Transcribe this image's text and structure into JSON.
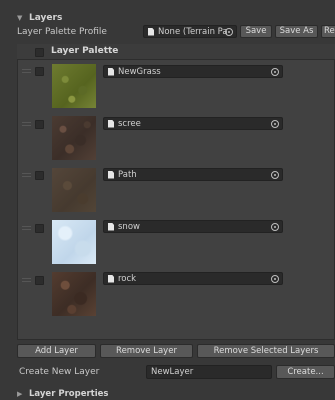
{
  "layers_section": {
    "title": "Layers",
    "arrow": "▼"
  },
  "profile": {
    "label": "Layer Palette Profile",
    "field_value": "None (Terrain Pa",
    "buttons": {
      "save": "Save",
      "save_as": "Save As",
      "reset": "Re"
    }
  },
  "palette": {
    "title": "Layer Palette",
    "layers": [
      {
        "name": "NewGrass",
        "texture": "grass-texture"
      },
      {
        "name": "scree",
        "texture": "scree-texture"
      },
      {
        "name": "Path",
        "texture": "path-texture"
      },
      {
        "name": "snow",
        "texture": "snow-texture"
      },
      {
        "name": "rock",
        "texture": "rock-texture"
      }
    ]
  },
  "actions": {
    "add_layer": "Add Layer",
    "remove_layer": "Remove Layer",
    "remove_selected": "Remove Selected Layers"
  },
  "create_new": {
    "label": "Create New Layer",
    "value": "NewLayer",
    "button": "Create..."
  },
  "layer_properties": {
    "title": "Layer Properties",
    "arrow": "▶"
  },
  "colors": {
    "background": "#383838",
    "field": "#2a2a2a",
    "button": "#585858",
    "text": "#c8c8c8"
  }
}
